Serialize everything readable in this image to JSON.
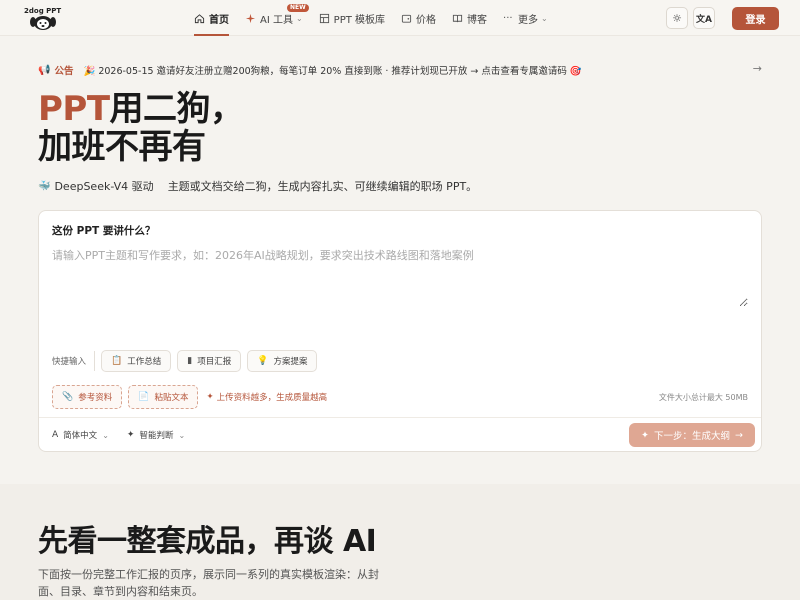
{
  "header": {
    "logo_text": "2dog PPT",
    "nav": [
      {
        "label": "首页",
        "icon": "home-icon",
        "active": true
      },
      {
        "label": "AI 工具",
        "icon": "sparkle-icon",
        "badge": "NEW",
        "has_dropdown": true
      },
      {
        "label": "PPT 模板库",
        "icon": "template-icon"
      },
      {
        "label": "价格",
        "icon": "wallet-icon"
      },
      {
        "label": "博客",
        "icon": "book-icon"
      },
      {
        "label": "更多",
        "icon": "dots-icon",
        "has_dropdown": true
      }
    ],
    "theme_icon": "sun-icon",
    "lang_icon": "translate-icon",
    "login_label": "登录"
  },
  "announcement": {
    "label": "公告",
    "text": "🎉 2026-05-15 邀请好友注册立赠200狗粮，每笔订单 20% 直接到账 · 推荐计划现已开放 → 点击查看专属邀请码 🎯",
    "arrow": "→"
  },
  "hero": {
    "title_accent": "PPT",
    "title_line1_rest": "用二狗，",
    "title_line2": "加班不再有",
    "model": "DeepSeek-V4 驱动",
    "tagline": "主题或文档交给二狗，生成内容扎实、可继续编辑的职场 PPT。"
  },
  "composer": {
    "question": "这份 PPT 要讲什么？",
    "placeholder": "请输入PPT主题和写作要求，如：2026年AI战略规划，要求突出技术路线图和落地案例",
    "quick_label": "快捷输入",
    "quick_chips": [
      {
        "label": "工作总结",
        "icon": "clipboard-icon"
      },
      {
        "label": "项目汇报",
        "icon": "bar-chart-icon"
      },
      {
        "label": "方案提案",
        "icon": "lightbulb-icon"
      }
    ],
    "upload_buttons": [
      {
        "label": "参考资料",
        "icon": "paperclip-icon"
      },
      {
        "label": "粘贴文本",
        "icon": "document-icon"
      }
    ],
    "upload_hint": "上传资料越多，生成质量越高",
    "size_note": "文件大小总计最大 50MB",
    "language": "简体中文",
    "mode": "智能判断",
    "next_label": "下一步：生成大纲",
    "next_arrow": "→"
  },
  "section2": {
    "title": "先看一整套成品，再谈 AI",
    "description": "下面按一份完整工作汇报的页序，展示同一系列的真实模板渲染：从封面、目录、章节到内容和结束页。"
  },
  "colors": {
    "accent": "#b5553a",
    "button_disabled": "#dfa793",
    "background": "#f5f3ef"
  }
}
